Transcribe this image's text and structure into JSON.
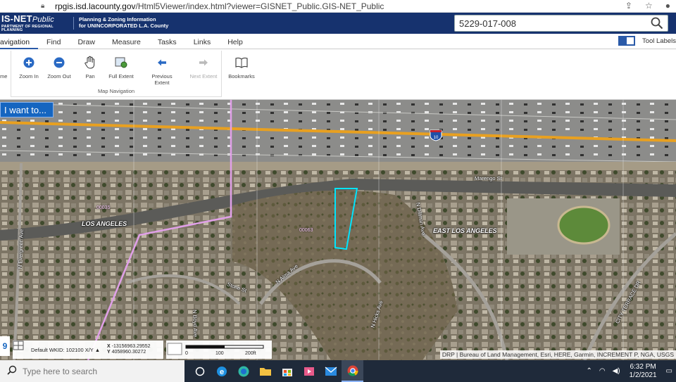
{
  "browser": {
    "url_host": "rpgis.isd.lacounty.gov",
    "url_path": "/Html5Viewer/index.html?viewer=GISNET_Public.GIS-NET_Public"
  },
  "header": {
    "brand_title": "IS-NET",
    "brand_title_suffix": "Public",
    "brand_subtitle": "PARTMENT OF REGIONAL PLANNING",
    "title_line1": "Planning & Zoning Information",
    "title_line2": "for UNINCORPORATED L.A. County",
    "search_value": "5229-017-008"
  },
  "menu": {
    "tabs": [
      "avigation",
      "Find",
      "Draw",
      "Measure",
      "Tasks",
      "Links",
      "Help"
    ],
    "tool_labels": "Tool Labels"
  },
  "ribbon": {
    "partial_label": "me",
    "buttons": {
      "zoom_in": "Zoom In",
      "zoom_out": "Zoom Out",
      "pan": "Pan",
      "full_extent": "Full Extent",
      "previous_extent": "Previous Extent",
      "next_extent": "Next Extent",
      "bookmarks": "Bookmarks"
    },
    "group_title": "Map Navigation"
  },
  "map": {
    "i_want_to": "I want to...",
    "labels": {
      "los_angeles": "LOS ANGELES",
      "east_los_angeles": "EAST LOS ANGELES",
      "marengo": "Marengo St",
      "n_evergreen": "N Evergreen Ave",
      "n_dillman": "N Dillman Ave",
      "stone_st": "Stone St",
      "n_alma": "N Alma Ave",
      "n_boyd": "N Boyd Ave",
      "n_hicks": "N Hicks Ave",
      "city_terrace": "CITY TERRACE DR",
      "parcel_a": "00035",
      "parcel_b": "00063",
      "shield": "10"
    },
    "attribution": "DRP | Bureau of Land Management, Esri, HERE, Garmin, INCREMENT P, NGA, USGS",
    "left_badge": "9",
    "wkid": "Default WKID: 102100 X/Y ▲",
    "x_label": "X",
    "y_label": "Y",
    "x_value": "-13156963.29552",
    "y_value": "4058960.30272",
    "scale_0": "0",
    "scale_100": "100",
    "scale_200": "200ft"
  },
  "taskbar": {
    "search_placeholder": "Type here to search",
    "time": "6:32 PM",
    "date": "1/2/2021"
  },
  "colors": {
    "header_bg": "#16326e",
    "accent": "#1565c0",
    "parcel_outline": "#00e5ff",
    "boundary": "#e0a0e8"
  }
}
